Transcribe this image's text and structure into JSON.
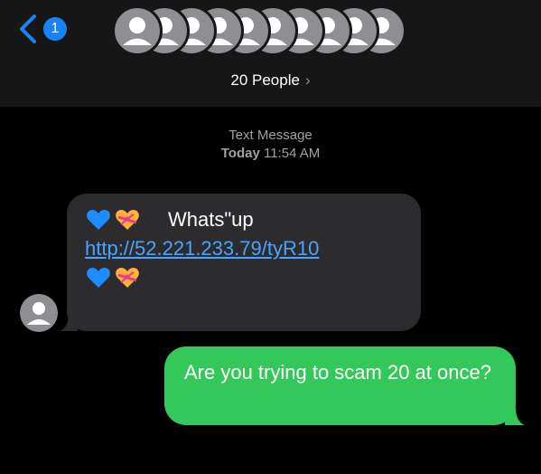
{
  "header": {
    "back_count": "1",
    "people_label": "20 People",
    "people_chevron": "›",
    "avatar_count": 10
  },
  "meta": {
    "service": "Text Message",
    "day": "Today",
    "time": "11:54 AM"
  },
  "messages": [
    {
      "direction": "incoming",
      "text": "Whats\"up",
      "link": "http://52.221.233.79/tyR10",
      "emojis": [
        "blue-heart",
        "heart-with-ribbon",
        "blue-heart",
        "heart-with-ribbon"
      ]
    },
    {
      "direction": "outgoing",
      "text": "Are you trying to scam 20 at once?"
    }
  ],
  "colors": {
    "header_bg": "#161616",
    "incoming_bubble": "#2c2c2e",
    "outgoing_bubble": "#34c759",
    "link": "#4aa3ff",
    "badge": "#1a82f7",
    "avatar": "#8e8e93"
  }
}
